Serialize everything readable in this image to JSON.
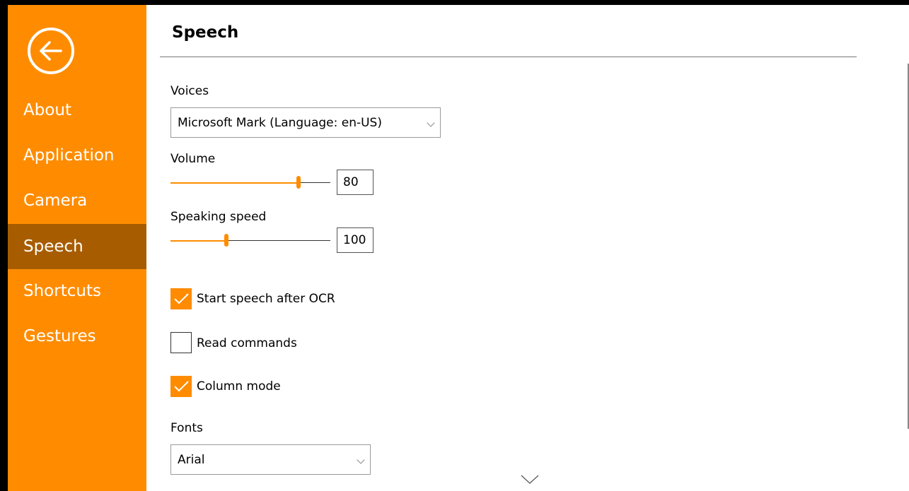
{
  "sidebar": {
    "back_icon": "back-arrow-circle-icon",
    "items": [
      {
        "label": "About",
        "active": false
      },
      {
        "label": "Application",
        "active": false
      },
      {
        "label": "Camera",
        "active": false
      },
      {
        "label": "Speech",
        "active": true
      },
      {
        "label": "Shortcuts",
        "active": false
      },
      {
        "label": "Gestures",
        "active": false
      }
    ]
  },
  "page": {
    "title": "Speech"
  },
  "voices": {
    "label": "Voices",
    "selected": "Microsoft Mark (Language: en-US)"
  },
  "volume": {
    "label": "Volume",
    "value": "80",
    "level": 0.8
  },
  "speaking_speed": {
    "label": "Speaking speed",
    "value": "100",
    "level": 0.35
  },
  "options": [
    {
      "label": "Start speech after OCR",
      "checked": true
    },
    {
      "label": "Read commands",
      "checked": false
    },
    {
      "label": "Column mode",
      "checked": true
    }
  ],
  "fonts": {
    "label": "Fonts",
    "selected": "Arial"
  },
  "colors": {
    "accent": "#ff8c00",
    "active_nav": "#a85c00"
  }
}
